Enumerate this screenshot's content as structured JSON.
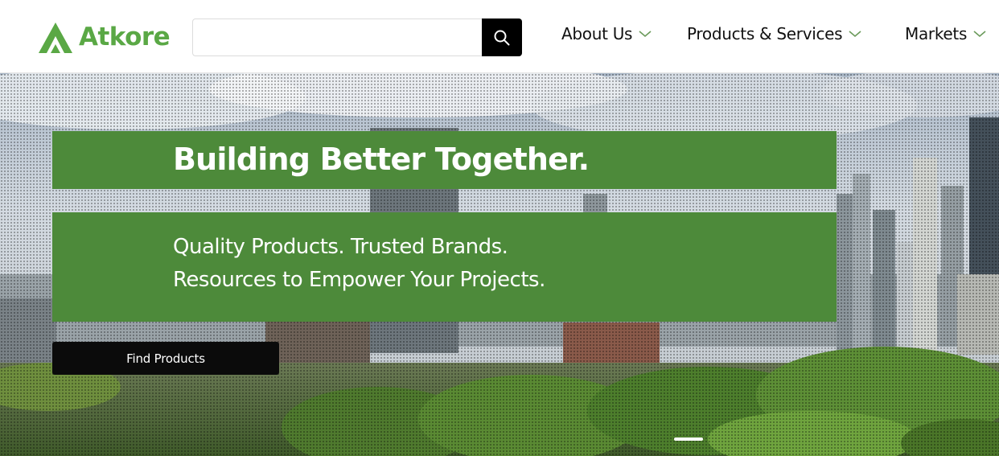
{
  "brand": {
    "name": "Atkore",
    "color": "#5aa845"
  },
  "header": {
    "search": {
      "value": "",
      "placeholder": "",
      "button_icon": "search-icon"
    },
    "nav": [
      {
        "label": "About Us",
        "icon": "chevron-down-icon"
      },
      {
        "label": "Products & Services",
        "icon": "chevron-down-icon"
      },
      {
        "label": "Markets",
        "icon": "chevron-down-icon"
      }
    ]
  },
  "hero": {
    "title": "Building Better Together.",
    "subtitle_line1": "Quality Products. Trusted Brands.",
    "subtitle_line2": "Resources to Empower Your Projects.",
    "cta_label": "Find Products",
    "banner_color": "#4d8a3a",
    "background": "city-skyline-photo"
  }
}
